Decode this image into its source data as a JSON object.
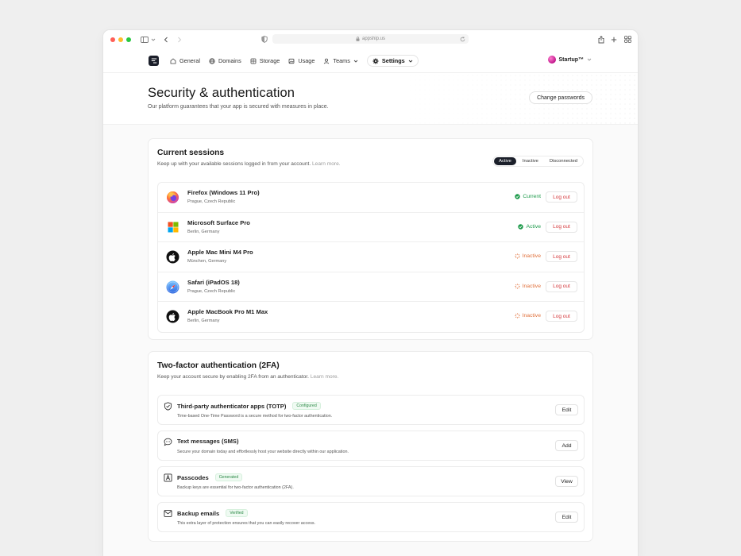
{
  "browser": {
    "url": "appship.us",
    "traffic_lights": [
      "#ff5f57",
      "#febc2e",
      "#28c840"
    ]
  },
  "nav": {
    "items": [
      {
        "label": "General",
        "icon": "home-icon"
      },
      {
        "label": "Domains",
        "icon": "globe-icon"
      },
      {
        "label": "Storage",
        "icon": "database-icon"
      },
      {
        "label": "Usage",
        "icon": "image-icon"
      },
      {
        "label": "Teams",
        "icon": "user-icon"
      }
    ],
    "settings_label": "Settings",
    "account": "Startup™"
  },
  "header": {
    "title": "Security & authentication",
    "subtitle": "Our platform guarantees that your app is secured with measures in place.",
    "change_passwords": "Change passwords"
  },
  "sessions": {
    "title": "Current sessions",
    "subtitle": "Keep up with your available sessions logged in from your account.",
    "learn_more": "Learn more.",
    "filters": [
      "Active",
      "Inactive",
      "Disconnected"
    ],
    "active_filter": "Active",
    "logout_label": "Log out",
    "rows": [
      {
        "name": "Firefox (Windows 11 Pro)",
        "location": "Prague, Czech Republic",
        "status": "Current",
        "icon": "firefox-icon"
      },
      {
        "name": "Microsoft Surface Pro",
        "location": "Berlin, Germany",
        "status": "Active",
        "icon": "microsoft-icon"
      },
      {
        "name": "Apple Mac Mini M4 Pro",
        "location": "München, Germany",
        "status": "Inactive",
        "icon": "apple-icon"
      },
      {
        "name": "Safari (iPadOS 18)",
        "location": "Prague, Czech Republic",
        "status": "Inactive",
        "icon": "safari-icon"
      },
      {
        "name": "Apple MacBook Pro M1 Max",
        "location": "Berlin, Germany",
        "status": "Inactive",
        "icon": "apple-icon"
      }
    ],
    "status_colors": {
      "green": "#1c9a4a",
      "orange": "#e0703a"
    }
  },
  "twofa": {
    "title": "Two-factor authentication (2FA)",
    "subtitle": "Keep your account secure by enabling 2FA from an authenticator.",
    "learn_more": "Learn more.",
    "methods": [
      {
        "name": "Third-party authenticator apps (TOTP)",
        "badge": "Configured",
        "description": "Time-based One-Time Password is a secure method for two-factor authentication.",
        "action": "Edit",
        "icon": "shield-check-icon"
      },
      {
        "name": "Text messages (SMS)",
        "badge": "",
        "description": "Secure your domain today and effortlessly host your website directly within our application.",
        "action": "Add",
        "icon": "message-icon"
      },
      {
        "name": "Passcodes",
        "badge": "Generated",
        "description": "Backup keys are essential for two-factor authentication (2FA).",
        "action": "View",
        "icon": "passcode-icon"
      },
      {
        "name": "Backup emails",
        "badge": "Verified",
        "description": "This extra layer of protection ensures that you can easily recover access.",
        "action": "Edit",
        "icon": "mail-icon"
      }
    ]
  }
}
